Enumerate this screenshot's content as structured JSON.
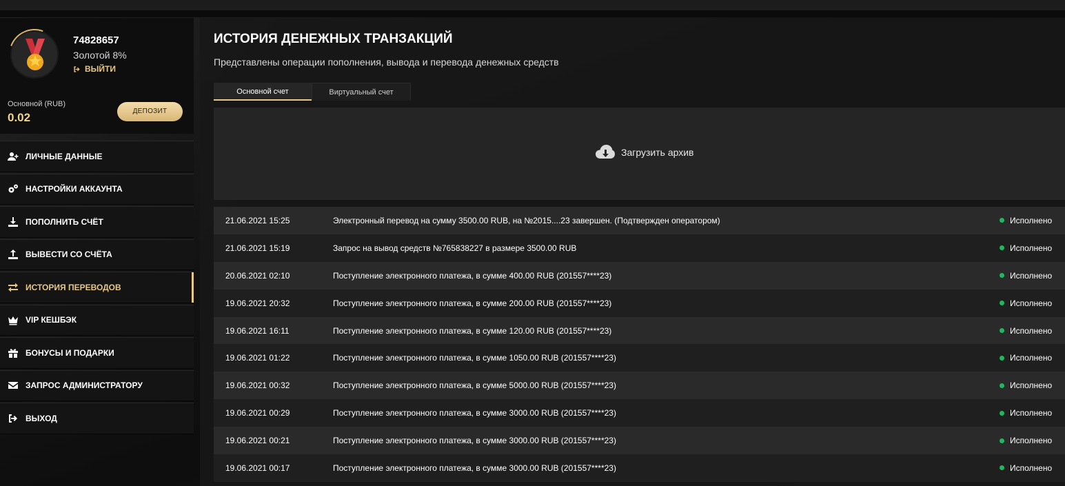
{
  "profile": {
    "user_id": "74828657",
    "level": "Золотой 8%",
    "logout_label": "ВЫЙТИ",
    "account_label": "Основной (RUB)",
    "balance": "0.02",
    "deposit_label": "ДЕПОЗИТ"
  },
  "menu": [
    {
      "label": "ЛИЧНЫЕ ДАННЫЕ",
      "icon": "user-plus-icon"
    },
    {
      "label": "НАСТРОЙКИ АККАУНТА",
      "icon": "gears-icon"
    },
    {
      "label": "ПОПОЛНИТЬ СЧЁТ",
      "icon": "download-icon"
    },
    {
      "label": "ВЫВЕСТИ СО СЧЁТА",
      "icon": "upload-icon"
    },
    {
      "label": "ИСТОРИЯ ПЕРЕВОДОВ",
      "icon": "exchange-icon",
      "active": true
    },
    {
      "label": "VIP КЕШБЭК",
      "icon": "crown-icon"
    },
    {
      "label": "БОНУСЫ И ПОДАРКИ",
      "icon": "gift-icon"
    },
    {
      "label": "ЗАПРОС АДМИНИСТРАТОРУ",
      "icon": "envelope-icon"
    },
    {
      "label": "ВЫХОД",
      "icon": "sign-out-icon"
    }
  ],
  "main": {
    "title": "ИСТОРИЯ ДЕНЕЖНЫХ ТРАНЗАКЦИЙ",
    "subtitle": "Представлены операции пополнения, вывода и перевода денежных средств",
    "tabs": [
      "Основной счет",
      "Виртуальный счет"
    ],
    "archive_label": "Загрузить архив"
  },
  "transactions": [
    {
      "date": "21.06.2021 15:25",
      "desc": "Электронный перевод на сумму 3500.00 RUB, на №2015....23 завершен. (Подтвержден оператором)",
      "status": "Исполнено"
    },
    {
      "date": "21.06.2021 15:19",
      "desc": "Запрос на вывод средств №765838227 в размере 3500.00 RUB",
      "status": "Исполнено"
    },
    {
      "date": "20.06.2021 02:10",
      "desc": "Поступление электронного платежа, в сумме 400.00 RUB (201557****23)",
      "status": "Исполнено"
    },
    {
      "date": "19.06.2021 20:32",
      "desc": "Поступление электронного платежа, в сумме 200.00 RUB (201557****23)",
      "status": "Исполнено"
    },
    {
      "date": "19.06.2021 16:11",
      "desc": "Поступление электронного платежа, в сумме 120.00 RUB (201557****23)",
      "status": "Исполнено"
    },
    {
      "date": "19.06.2021 01:22",
      "desc": "Поступление электронного платежа, в сумме 1050.00 RUB (201557****23)",
      "status": "Исполнено"
    },
    {
      "date": "19.06.2021 00:32",
      "desc": "Поступление электронного платежа, в сумме 5000.00 RUB (201557****23)",
      "status": "Исполнено"
    },
    {
      "date": "19.06.2021 00:29",
      "desc": "Поступление электронного платежа, в сумме 3000.00 RUB (201557****23)",
      "status": "Исполнено"
    },
    {
      "date": "19.06.2021 00:21",
      "desc": "Поступление электронного платежа, в сумме 3000.00 RUB (201557****23)",
      "status": "Исполнено"
    },
    {
      "date": "19.06.2021 00:17",
      "desc": "Поступление электронного платежа, в сумме 3000.00 RUB (201557****23)",
      "status": "Исполнено"
    }
  ],
  "colors": {
    "accent": "#e6c787",
    "status_ok": "#23b562"
  }
}
